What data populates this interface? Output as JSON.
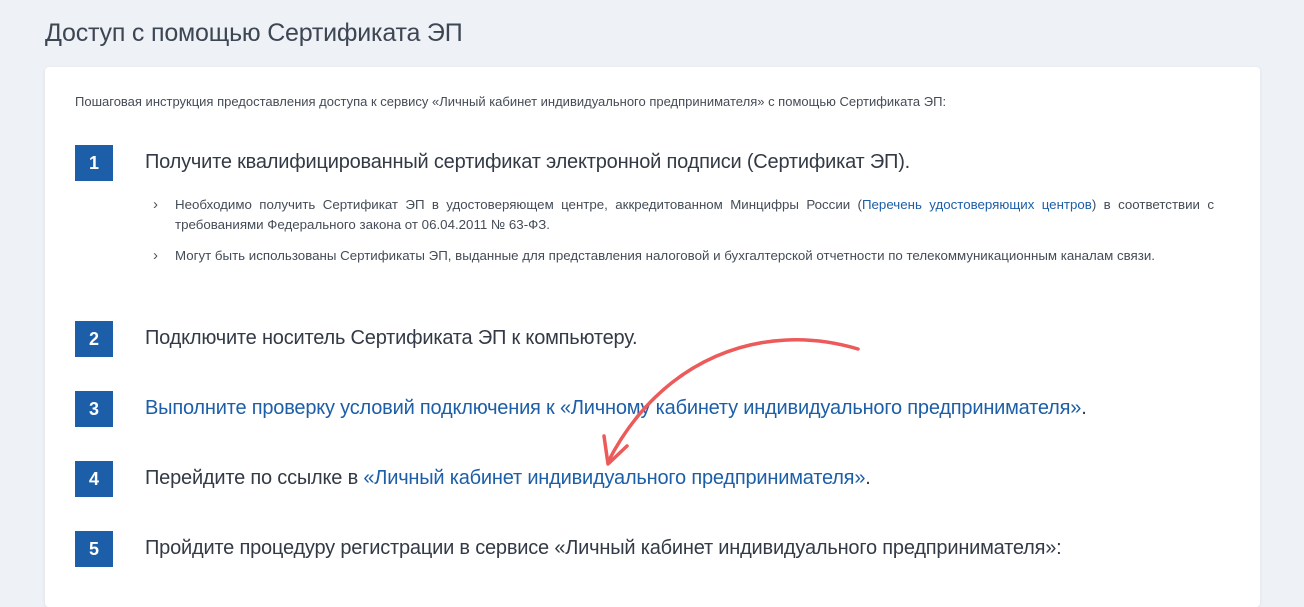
{
  "page": {
    "title": "Доступ с помощью Сертификата ЭП"
  },
  "intro": "Пошаговая инструкция предоставления доступа к сервису «Личный кабинет индивидуального предпринимателя» с помощью Сертификата ЭП:",
  "steps": [
    {
      "num": "1",
      "text": "Получите квалифицированный сертификат электронной подписи (Сертификат ЭП).",
      "bullets": [
        {
          "pre": "Необходимо получить Сертификат ЭП в удостоверяющем центре, аккредитованном Минцифры России (",
          "link": "Перечень удостоверяющих центров",
          "post": ") в соответствии с требованиями Федерального закона от 06.04.2011 № 63-ФЗ."
        },
        {
          "text": "Могут быть использованы Сертификаты ЭП, выданные для представления налоговой и бухгалтерской отчетности по телекоммуникационным каналам связи."
        }
      ]
    },
    {
      "num": "2",
      "text": "Подключите носитель Сертификата ЭП к компьютеру."
    },
    {
      "num": "3",
      "link": "Выполните проверку условий подключения к «Личному кабинету индивидуального предпринимателя»",
      "post": "."
    },
    {
      "num": "4",
      "pre": "Перейдите по ссылке в ",
      "link": "«Личный кабинет индивидуального предпринимателя»",
      "post": "."
    },
    {
      "num": "5",
      "text": "Пройдите процедуру регистрации в сервисе «Личный кабинет индивидуального предпринимателя»:"
    }
  ],
  "colors": {
    "accent": "#1c5ea8",
    "annotation_arrow": "#ec5a5a"
  },
  "icons": {
    "bullet": "chevron-right-icon",
    "annotation": "curved-arrow-icon"
  }
}
